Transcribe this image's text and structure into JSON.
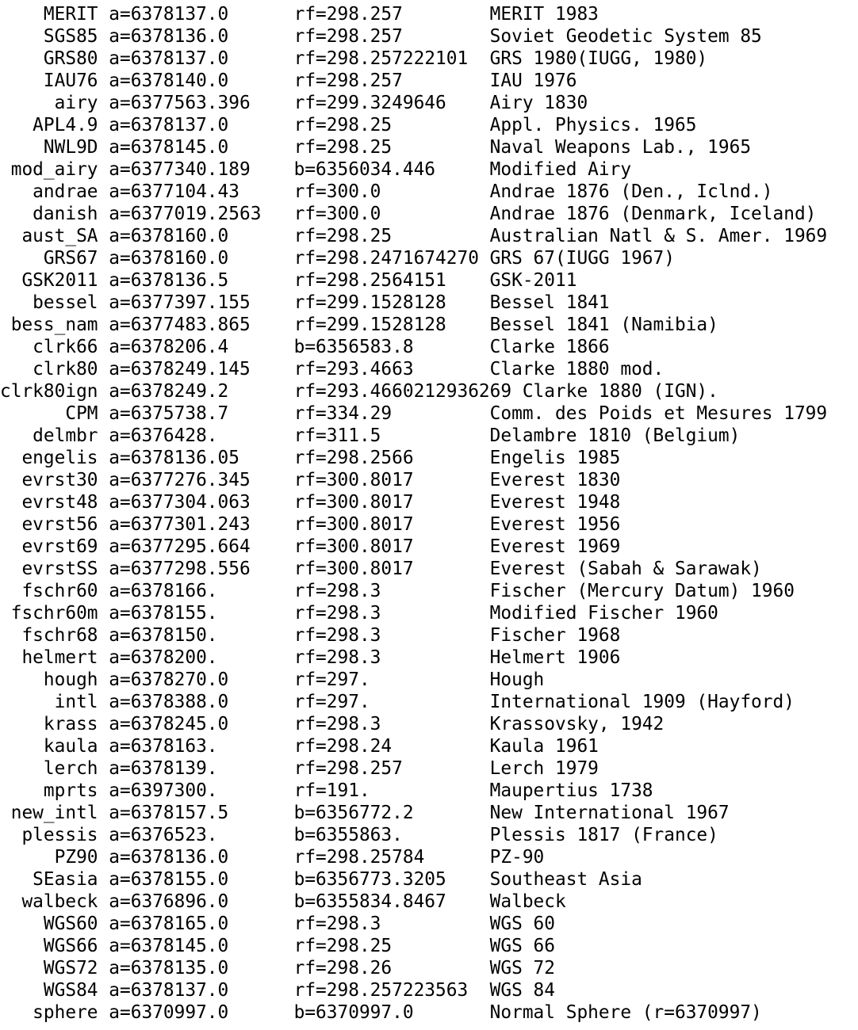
{
  "ellipsoids": [
    {
      "name": "MERIT",
      "a": "a=6378137.0",
      "param": "rf=298.257",
      "description": "MERIT 1983"
    },
    {
      "name": "SGS85",
      "a": "a=6378136.0",
      "param": "rf=298.257",
      "description": "Soviet Geodetic System 85"
    },
    {
      "name": "GRS80",
      "a": "a=6378137.0",
      "param": "rf=298.257222101",
      "description": "GRS 1980(IUGG, 1980)"
    },
    {
      "name": "IAU76",
      "a": "a=6378140.0",
      "param": "rf=298.257",
      "description": "IAU 1976"
    },
    {
      "name": "airy",
      "a": "a=6377563.396",
      "param": "rf=299.3249646",
      "description": "Airy 1830"
    },
    {
      "name": "APL4.9",
      "a": "a=6378137.0",
      "param": "rf=298.25",
      "description": "Appl. Physics. 1965"
    },
    {
      "name": "NWL9D",
      "a": "a=6378145.0",
      "param": "rf=298.25",
      "description": "Naval Weapons Lab., 1965"
    },
    {
      "name": "mod_airy",
      "a": "a=6377340.189",
      "param": "b=6356034.446",
      "description": "Modified Airy"
    },
    {
      "name": "andrae",
      "a": "a=6377104.43",
      "param": "rf=300.0",
      "description": "Andrae 1876 (Den., Iclnd.)"
    },
    {
      "name": "danish",
      "a": "a=6377019.2563",
      "param": "rf=300.0",
      "description": "Andrae 1876 (Denmark, Iceland)"
    },
    {
      "name": "aust_SA",
      "a": "a=6378160.0",
      "param": "rf=298.25",
      "description": "Australian Natl & S. Amer. 1969"
    },
    {
      "name": "GRS67",
      "a": "a=6378160.0",
      "param": "rf=298.2471674270",
      "description": "GRS 67(IUGG 1967)"
    },
    {
      "name": "GSK2011",
      "a": "a=6378136.5",
      "param": "rf=298.2564151",
      "description": "GSK-2011"
    },
    {
      "name": "bessel",
      "a": "a=6377397.155",
      "param": "rf=299.1528128",
      "description": "Bessel 1841"
    },
    {
      "name": "bess_nam",
      "a": "a=6377483.865",
      "param": "rf=299.1528128",
      "description": "Bessel 1841 (Namibia)"
    },
    {
      "name": "clrk66",
      "a": "a=6378206.4",
      "param": "b=6356583.8",
      "description": "Clarke 1866"
    },
    {
      "name": "clrk80",
      "a": "a=6378249.145",
      "param": "rf=293.4663",
      "description": "Clarke 1880 mod."
    },
    {
      "name": "clrk80ign",
      "a": "a=6378249.2",
      "param": "rf=293.4660212936269",
      "description": "Clarke 1880 (IGN)."
    },
    {
      "name": "CPM",
      "a": "a=6375738.7",
      "param": "rf=334.29",
      "description": "Comm. des Poids et Mesures 1799"
    },
    {
      "name": "delmbr",
      "a": "a=6376428.",
      "param": "rf=311.5",
      "description": "Delambre 1810 (Belgium)"
    },
    {
      "name": "engelis",
      "a": "a=6378136.05",
      "param": "rf=298.2566",
      "description": "Engelis 1985"
    },
    {
      "name": "evrst30",
      "a": "a=6377276.345",
      "param": "rf=300.8017",
      "description": "Everest 1830"
    },
    {
      "name": "evrst48",
      "a": "a=6377304.063",
      "param": "rf=300.8017",
      "description": "Everest 1948"
    },
    {
      "name": "evrst56",
      "a": "a=6377301.243",
      "param": "rf=300.8017",
      "description": "Everest 1956"
    },
    {
      "name": "evrst69",
      "a": "a=6377295.664",
      "param": "rf=300.8017",
      "description": "Everest 1969"
    },
    {
      "name": "evrstSS",
      "a": "a=6377298.556",
      "param": "rf=300.8017",
      "description": "Everest (Sabah & Sarawak)"
    },
    {
      "name": "fschr60",
      "a": "a=6378166.",
      "param": "rf=298.3",
      "description": "Fischer (Mercury Datum) 1960"
    },
    {
      "name": "fschr60m",
      "a": "a=6378155.",
      "param": "rf=298.3",
      "description": "Modified Fischer 1960"
    },
    {
      "name": "fschr68",
      "a": "a=6378150.",
      "param": "rf=298.3",
      "description": "Fischer 1968"
    },
    {
      "name": "helmert",
      "a": "a=6378200.",
      "param": "rf=298.3",
      "description": "Helmert 1906"
    },
    {
      "name": "hough",
      "a": "a=6378270.0",
      "param": "rf=297.",
      "description": "Hough"
    },
    {
      "name": "intl",
      "a": "a=6378388.0",
      "param": "rf=297.",
      "description": "International 1909 (Hayford)"
    },
    {
      "name": "krass",
      "a": "a=6378245.0",
      "param": "rf=298.3",
      "description": "Krassovsky, 1942"
    },
    {
      "name": "kaula",
      "a": "a=6378163.",
      "param": "rf=298.24",
      "description": "Kaula 1961"
    },
    {
      "name": "lerch",
      "a": "a=6378139.",
      "param": "rf=298.257",
      "description": "Lerch 1979"
    },
    {
      "name": "mprts",
      "a": "a=6397300.",
      "param": "rf=191.",
      "description": "Maupertius 1738"
    },
    {
      "name": "new_intl",
      "a": "a=6378157.5",
      "param": "b=6356772.2",
      "description": "New International 1967"
    },
    {
      "name": "plessis",
      "a": "a=6376523.",
      "param": "b=6355863.",
      "description": "Plessis 1817 (France)"
    },
    {
      "name": "PZ90",
      "a": "a=6378136.0",
      "param": "rf=298.25784",
      "description": "PZ-90"
    },
    {
      "name": "SEasia",
      "a": "a=6378155.0",
      "param": "b=6356773.3205",
      "description": "Southeast Asia"
    },
    {
      "name": "walbeck",
      "a": "a=6376896.0",
      "param": "b=6355834.8467",
      "description": "Walbeck"
    },
    {
      "name": "WGS60",
      "a": "a=6378165.0",
      "param": "rf=298.3",
      "description": "WGS 60"
    },
    {
      "name": "WGS66",
      "a": "a=6378145.0",
      "param": "rf=298.25",
      "description": "WGS 66"
    },
    {
      "name": "WGS72",
      "a": "a=6378135.0",
      "param": "rf=298.26",
      "description": "WGS 72"
    },
    {
      "name": "WGS84",
      "a": "a=6378137.0",
      "param": "rf=298.257223563",
      "description": "WGS 84"
    },
    {
      "name": "sphere",
      "a": "a=6370997.0",
      "param": "b=6370997.0",
      "description": "Normal Sphere (r=6370997)"
    }
  ]
}
